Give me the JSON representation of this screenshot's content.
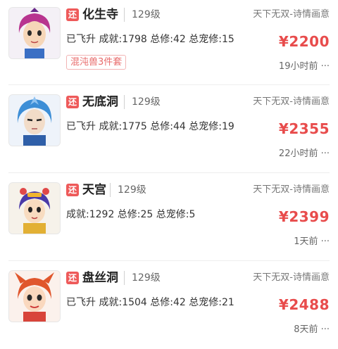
{
  "listings": [
    {
      "badge": "还",
      "sect": "化生寺",
      "level": "129级",
      "server": "天下无双-诗情画意",
      "stats": "已飞升 成就:1798 总修:42 总宠修:15",
      "price": "¥2200",
      "tag": "混沌兽3件套",
      "time": "19小时前 ···",
      "avatar_icon": "character-avatar-icon",
      "hair_color": "#b8348f"
    },
    {
      "badge": "还",
      "sect": "无底洞",
      "level": "129级",
      "server": "天下无双-诗情画意",
      "stats": "已飞升 成就:1775 总修:44 总宠修:19",
      "price": "¥2355",
      "tag": "",
      "time": "22小时前 ···",
      "avatar_icon": "character-avatar-icon",
      "hair_color": "#3d8ed6"
    },
    {
      "badge": "还",
      "sect": "天宫",
      "level": "129级",
      "server": "天下无双-诗情画意",
      "stats": "成就:1292 总修:25 总宠修:5",
      "price": "¥2399",
      "tag": "",
      "time": "1天前 ···",
      "avatar_icon": "character-avatar-icon",
      "hair_color": "#4a3aa8"
    },
    {
      "badge": "还",
      "sect": "盘丝洞",
      "level": "129级",
      "server": "天下无双-诗情画意",
      "stats": "已飞升 成就:1504 总修:42 总宠修:21",
      "price": "¥2488",
      "tag": "",
      "time": "8天前 ···",
      "avatar_icon": "character-avatar-icon",
      "hair_color": "#e0562c"
    }
  ],
  "colors": {
    "accent": "#e84c4c",
    "badge": "#ee5a5a"
  }
}
